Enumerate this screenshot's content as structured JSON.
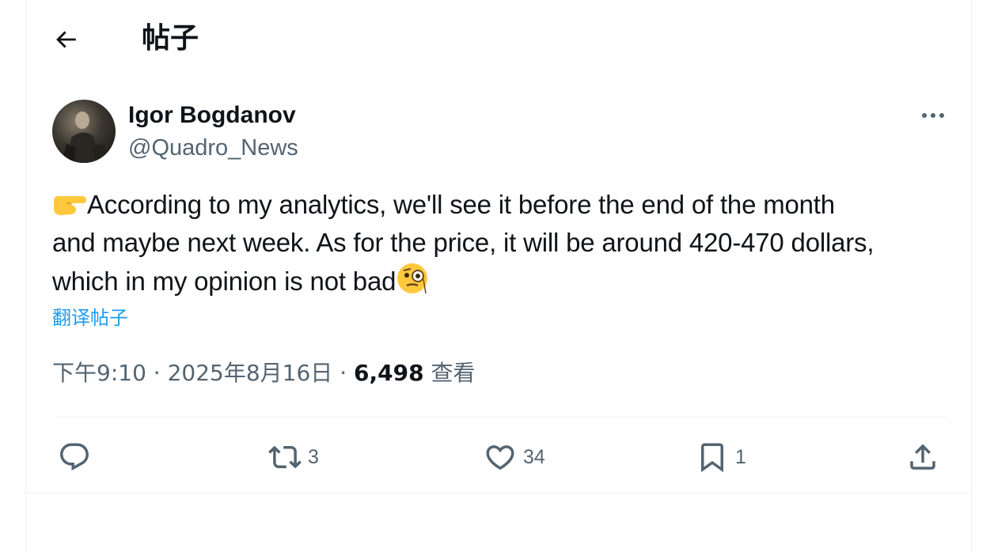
{
  "header": {
    "back_icon": "arrow-left-icon",
    "title": "帖子"
  },
  "author": {
    "display_name": "Igor Bogdanov",
    "handle": "@Quadro_News",
    "avatar_icon": "avatar-photo"
  },
  "more_icon": "ellipsis-icon",
  "tweet": {
    "text_line1": "According to my analytics, we'll see it before the end of the month",
    "text_line2": "and maybe next week. As for the price, it will be around 420-470 dollars,",
    "text_line3": "which in my opinion is not bad",
    "leading_emoji": "👉",
    "trailing_emoji": "🧐",
    "translate_label": "翻译帖子"
  },
  "meta": {
    "time": "下午9:10",
    "separator": "·",
    "date": "2025年8月16日",
    "views_count": "6,498",
    "views_label": "查看"
  },
  "actions": {
    "reply": {
      "icon": "reply-icon",
      "count": ""
    },
    "retweet": {
      "icon": "retweet-icon",
      "count": "3"
    },
    "like": {
      "icon": "heart-icon",
      "count": "34"
    },
    "bookmark": {
      "icon": "bookmark-icon",
      "count": "1"
    },
    "share": {
      "icon": "share-icon"
    }
  },
  "colors": {
    "text": "#0f1419",
    "secondary": "#536471",
    "link": "#1d9bf0",
    "divider": "#eff3f4"
  }
}
